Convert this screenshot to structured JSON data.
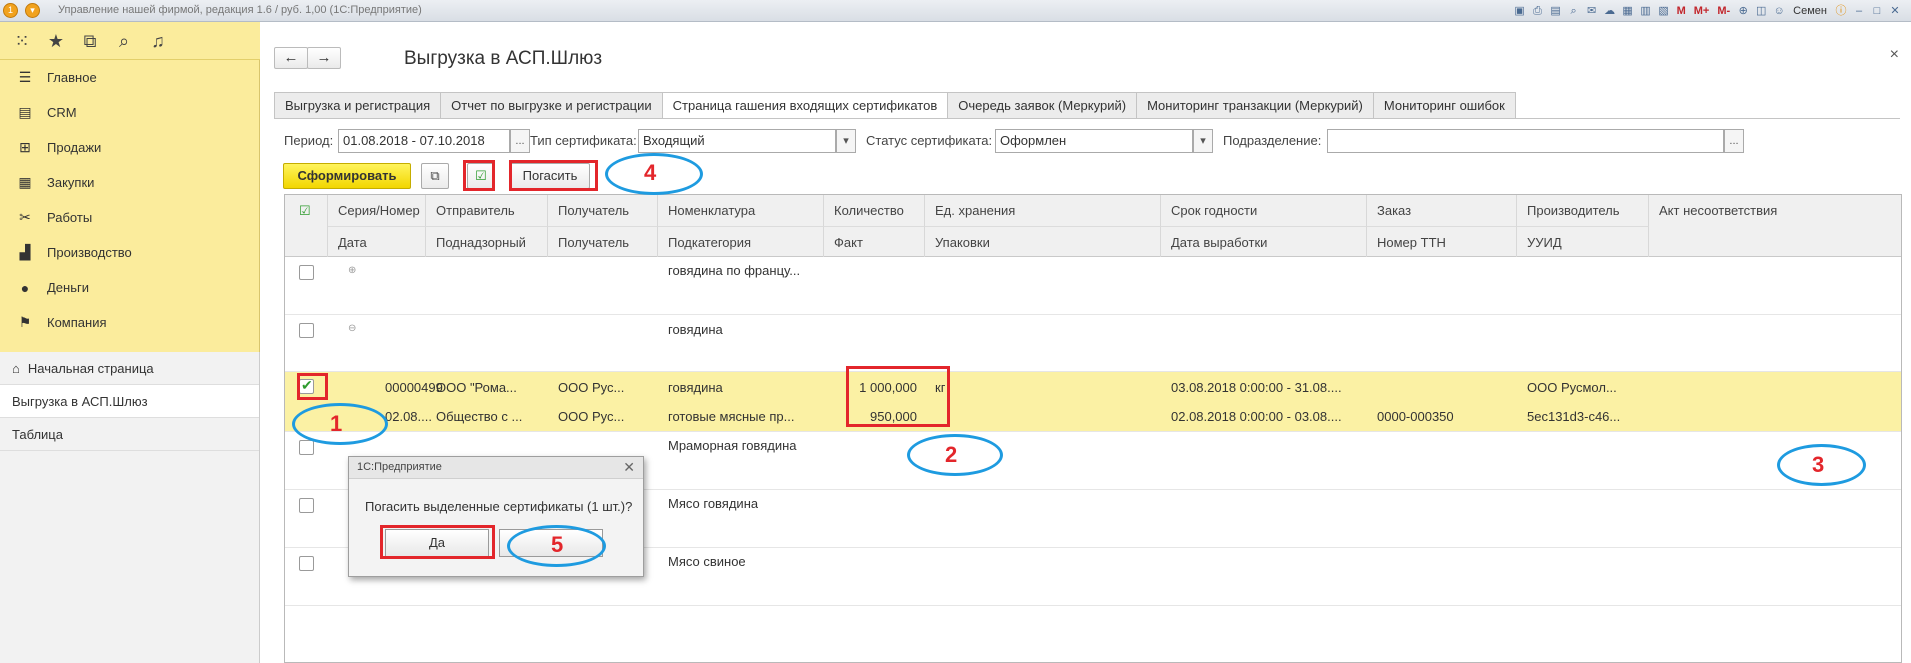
{
  "window": {
    "title": "Управление нашей фирмой, редакция 1.6 / руб. 1,00  (1С:Предприятие)",
    "user": "Семен",
    "toolbar_labels": [
      "M",
      "M+",
      "M-"
    ]
  },
  "sidebar": {
    "items": [
      {
        "label": "Главное",
        "icon": "menu-lines-icon"
      },
      {
        "label": "CRM",
        "icon": "crm-icon"
      },
      {
        "label": "Продажи",
        "icon": "cart-icon"
      },
      {
        "label": "Закупки",
        "icon": "purchase-icon"
      },
      {
        "label": "Работы",
        "icon": "tools-icon"
      },
      {
        "label": "Производство",
        "icon": "factory-icon"
      },
      {
        "label": "Деньги",
        "icon": "money-icon"
      },
      {
        "label": "Компания",
        "icon": "flag-icon"
      }
    ],
    "open_windows": [
      {
        "label": "Начальная страница"
      },
      {
        "label": "Выгрузка в АСП.Шлюз"
      },
      {
        "label": "Таблица"
      }
    ]
  },
  "page": {
    "title": "Выгрузка в АСП.Шлюз",
    "tabs": [
      {
        "label": "Выгрузка и регистрация"
      },
      {
        "label": "Отчет по выгрузке и регистрации"
      },
      {
        "label": "Страница гашения входящих сертификатов"
      },
      {
        "label": "Очередь заявок (Меркурий)"
      },
      {
        "label": "Мониторинг транзакции (Меркурий)"
      },
      {
        "label": "Мониторинг ошибок"
      }
    ]
  },
  "filters": {
    "period_label": "Период:",
    "period_value": "01.08.2018 - 07.10.2018",
    "type_label": "Тип сертификата:",
    "type_value": "Входящий",
    "status_label": "Статус сертификата:",
    "status_value": "Оформлен",
    "division_label": "Подразделение:",
    "division_value": ""
  },
  "commands": {
    "form_label": "Сформировать",
    "pogasit_label": "Погасить"
  },
  "table": {
    "headers_row1": [
      "Серия/Номер",
      "Отправитель",
      "Получатель",
      "Номенклатура",
      "Количество",
      "Ед. хранения",
      "Срок годности",
      "Заказ",
      "Производитель",
      "Акт несоответствия"
    ],
    "headers_row2": [
      "Дата",
      "Поднадзорный",
      "Получатель",
      "Подкатегория",
      "Факт",
      "Упаковки",
      "Дата выработки",
      "Номер ТТН",
      "УУИД",
      ""
    ],
    "groups": [
      {
        "name": "говядина по францу...",
        "tree": "⊕"
      },
      {
        "name": "говядина",
        "tree": "⊖"
      }
    ],
    "selected": {
      "checked": true,
      "r1": [
        "00000499",
        "ООО \"Рома...",
        "ООО Рус...",
        "говядина",
        "1 000,000",
        "кг",
        "03.08.2018 0:00:00 - 31.08....",
        "",
        "ООО Русмол...",
        ""
      ],
      "r2": [
        "02.08....",
        "Общество с ...",
        "ООО Рус...",
        "готовые мясные пр...",
        "950,000",
        "",
        "02.08.2018 0:00:00 - 03.08....",
        "0000-000350",
        "5ec131d3-c46...",
        ""
      ]
    },
    "groups_after": [
      {
        "name": "Мраморная говядина"
      },
      {
        "name": "Мясо говядина"
      },
      {
        "name": "Мясо свиное"
      }
    ]
  },
  "dialog": {
    "title": "1С:Предприятие",
    "message": "Погасить выделенные сертификаты (1 шт.)?",
    "yes_label": "Да"
  },
  "annotations": [
    "1",
    "2",
    "3",
    "4",
    "5"
  ],
  "colors": {
    "sidebar_bg": "#fbec9c",
    "selected_row": "#fbf1a4",
    "primary_button": "#f2d600",
    "annotation_red": "#e3262b",
    "annotation_blue": "#1e9be0"
  }
}
